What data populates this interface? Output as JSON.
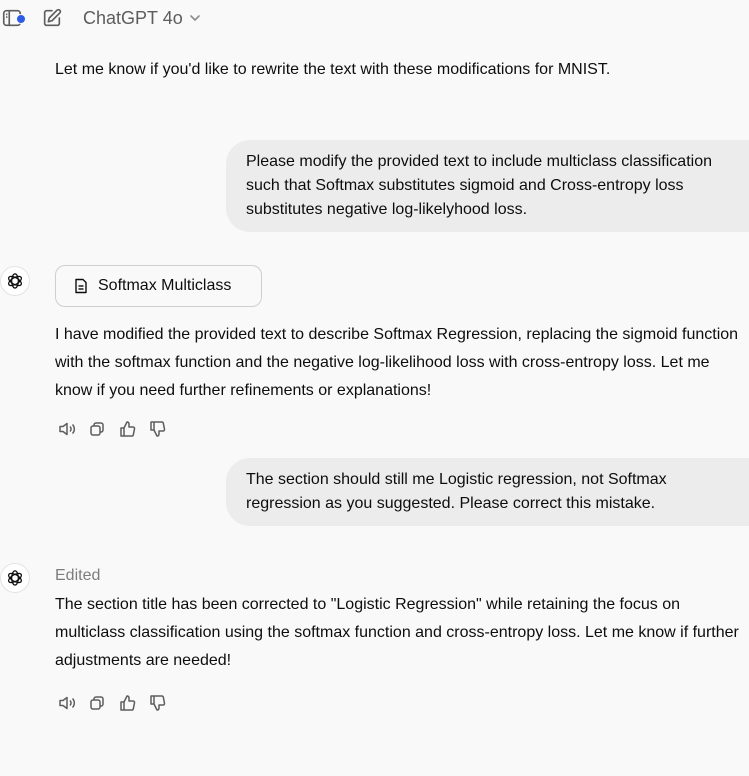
{
  "header": {
    "model_name": "ChatGPT 4o",
    "icons": [
      "sidebar-toggle-icon",
      "new-chat-icon",
      "chevron-down-icon"
    ]
  },
  "messages": [
    {
      "role": "assistant",
      "text": "Let me know if you'd like to rewrite the text with these modifications for MNIST."
    },
    {
      "role": "user",
      "text": "Please modify the provided text to include multiclass classification\nsuch that Softmax substitutes sigmoid and Cross-entropy loss\nsubstitutes negative log-likelyhood loss."
    },
    {
      "role": "assistant",
      "document_chip": "Softmax Multiclass",
      "text": "I have modified the provided text to describe Softmax Regression, replacing the sigmoid function\nwith the softmax function and the negative log-likelihood loss with cross-entropy loss. Let me\nknow if you need further refinements or explanations!"
    },
    {
      "role": "user",
      "text": "The section should still me Logistic regression, not Softmax\nregression as you suggested. Please correct this mistake."
    },
    {
      "role": "assistant",
      "status": "Edited",
      "text": "The section title has been corrected to \"Logistic Regression\" while retaining the focus on\nmulticlass classification using the softmax function and cross-entropy loss. Let me know if further\nadjustments are needed!"
    }
  ],
  "message_actions": [
    "read-aloud-icon",
    "copy-icon",
    "thumbs-up-icon",
    "thumbs-down-icon"
  ],
  "colors": {
    "background": "#f9f9f9",
    "user_bubble": "#ececec",
    "notification_dot": "#2b5de6"
  }
}
